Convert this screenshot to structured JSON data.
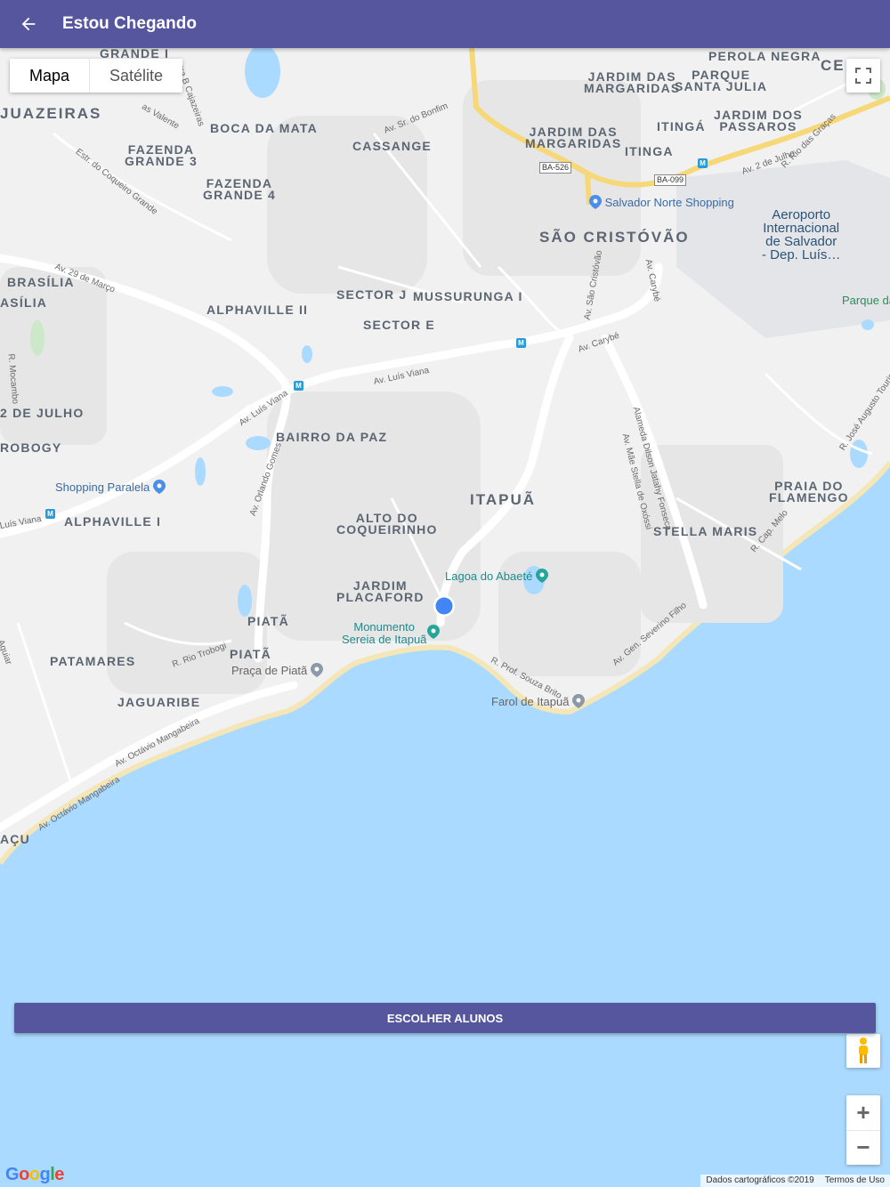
{
  "appbar": {
    "title": "Estou Chegando",
    "back_icon": "arrow-left-icon"
  },
  "map": {
    "type_toggle": {
      "active": "Mapa",
      "inactive": "Satélite"
    },
    "area_labels": [
      {
        "text": "PEROLA NEGRA"
      },
      {
        "text": "CE"
      },
      {
        "text": "GRANDE I"
      },
      {
        "text": "JARDIM DAS\nMARGARIDAS"
      },
      {
        "text": "PARQUE\nSANTA JULIA"
      },
      {
        "text": "JUAZEIRAS"
      },
      {
        "text": "BOCA DA MATA"
      },
      {
        "text": "JARDIM DAS\nMARGARIDAS"
      },
      {
        "text": "ITINGÁ"
      },
      {
        "text": "JARDIM DOS\nPASSAROS"
      },
      {
        "text": "CASSANGE"
      },
      {
        "text": "ITINGA"
      },
      {
        "text": "FAZENDA\nGRANDE 3"
      },
      {
        "text": "FAZENDA\nGRANDE 4"
      },
      {
        "text": "SÃO CRISTÓVÃO"
      },
      {
        "text": "BRASÍLIA"
      },
      {
        "text": "ASÍLIA"
      },
      {
        "text": "SECTOR J"
      },
      {
        "text": "MUSSURUNGA I"
      },
      {
        "text": "ALPHAVILLE II"
      },
      {
        "text": "SECTOR E"
      },
      {
        "text": "2 DE JULHO"
      },
      {
        "text": "BAIRRO DA PAZ"
      },
      {
        "text": "ROBOGY"
      },
      {
        "text": "ITAPUÃ"
      },
      {
        "text": "PRAIA DO\nFLAMENGO"
      },
      {
        "text": "ALPHAVILLE I"
      },
      {
        "text": "ALTO DO\nCOQUEIRINHO"
      },
      {
        "text": "STELLA MARIS"
      },
      {
        "text": "JARDIM\nPLACAFORD"
      },
      {
        "text": "PIATÃ"
      },
      {
        "text": "PATAMARES"
      },
      {
        "text": "PIATÃ"
      },
      {
        "text": "JAGUARIBE"
      },
      {
        "text": "AÇU"
      }
    ],
    "street_labels": [
      {
        "text": "Av. Sr. do Bonfim"
      },
      {
        "text": "Estr. do Coqueiro Grande"
      },
      {
        "text": "Av. 29 de Março"
      },
      {
        "text": "Av. Luís Viana"
      },
      {
        "text": "Av. Luís Viana"
      },
      {
        "text": "Av. Carybé"
      },
      {
        "text": "Av. São Cristóvão"
      },
      {
        "text": "Av. Carybé"
      },
      {
        "text": "Av. 2 de Julho"
      },
      {
        "text": "R. Rio das Graças"
      },
      {
        "text": "R. Mocambo"
      },
      {
        "text": "Av. Orlando Gomes"
      },
      {
        "text": "Luís Viana"
      },
      {
        "text": "Alameda Dilson Jatahy Fonseca"
      },
      {
        "text": "Av. Mãe Stella de Oxóssi"
      },
      {
        "text": "R. José Augusto Tourinho"
      },
      {
        "text": "R. Cap. Melo"
      },
      {
        "text": "Av. Gen. Severino Filho"
      },
      {
        "text": "R. Prof. Souza Brito"
      },
      {
        "text": "R. Rio Trobogi"
      },
      {
        "text": "Av. Octávio Mangabeira"
      },
      {
        "text": "Av. Octávio Mangabeira"
      },
      {
        "text": "Aguiar"
      },
      {
        "text": "etra B Cajazeiras"
      },
      {
        "text": "as Valente"
      }
    ],
    "shields": [
      "BA-526",
      "BA-099"
    ],
    "pois": [
      {
        "text": "Salvador Norte Shopping"
      },
      {
        "text": "Aeroporto\nInternacional\nde Salvador\n- Dep. Luís…"
      },
      {
        "text": "Parque da"
      },
      {
        "text": "Shopping Paralela"
      },
      {
        "text": "Lagoa do Abaeté"
      },
      {
        "text": "Monumento\nSereia de Itapuã"
      },
      {
        "text": "Praça de Piatã"
      },
      {
        "text": "Farol de Itapuã"
      }
    ],
    "controls": {
      "fullscreen_icon": "fullscreen-icon",
      "pegman_icon": "pegman-icon",
      "zoom_in": "+",
      "zoom_out": "−"
    },
    "logo": "Google",
    "footer": {
      "data": "Dados cartográficos ©2019",
      "terms": "Termos de Uso"
    }
  },
  "action": {
    "choose_label": "ESCOLHER ALUNOS"
  },
  "colors": {
    "appbar": "#55569e",
    "water": "#aadaff",
    "land": "#f1f1f1",
    "location": "#4285f4",
    "highway": "#f6d879"
  }
}
